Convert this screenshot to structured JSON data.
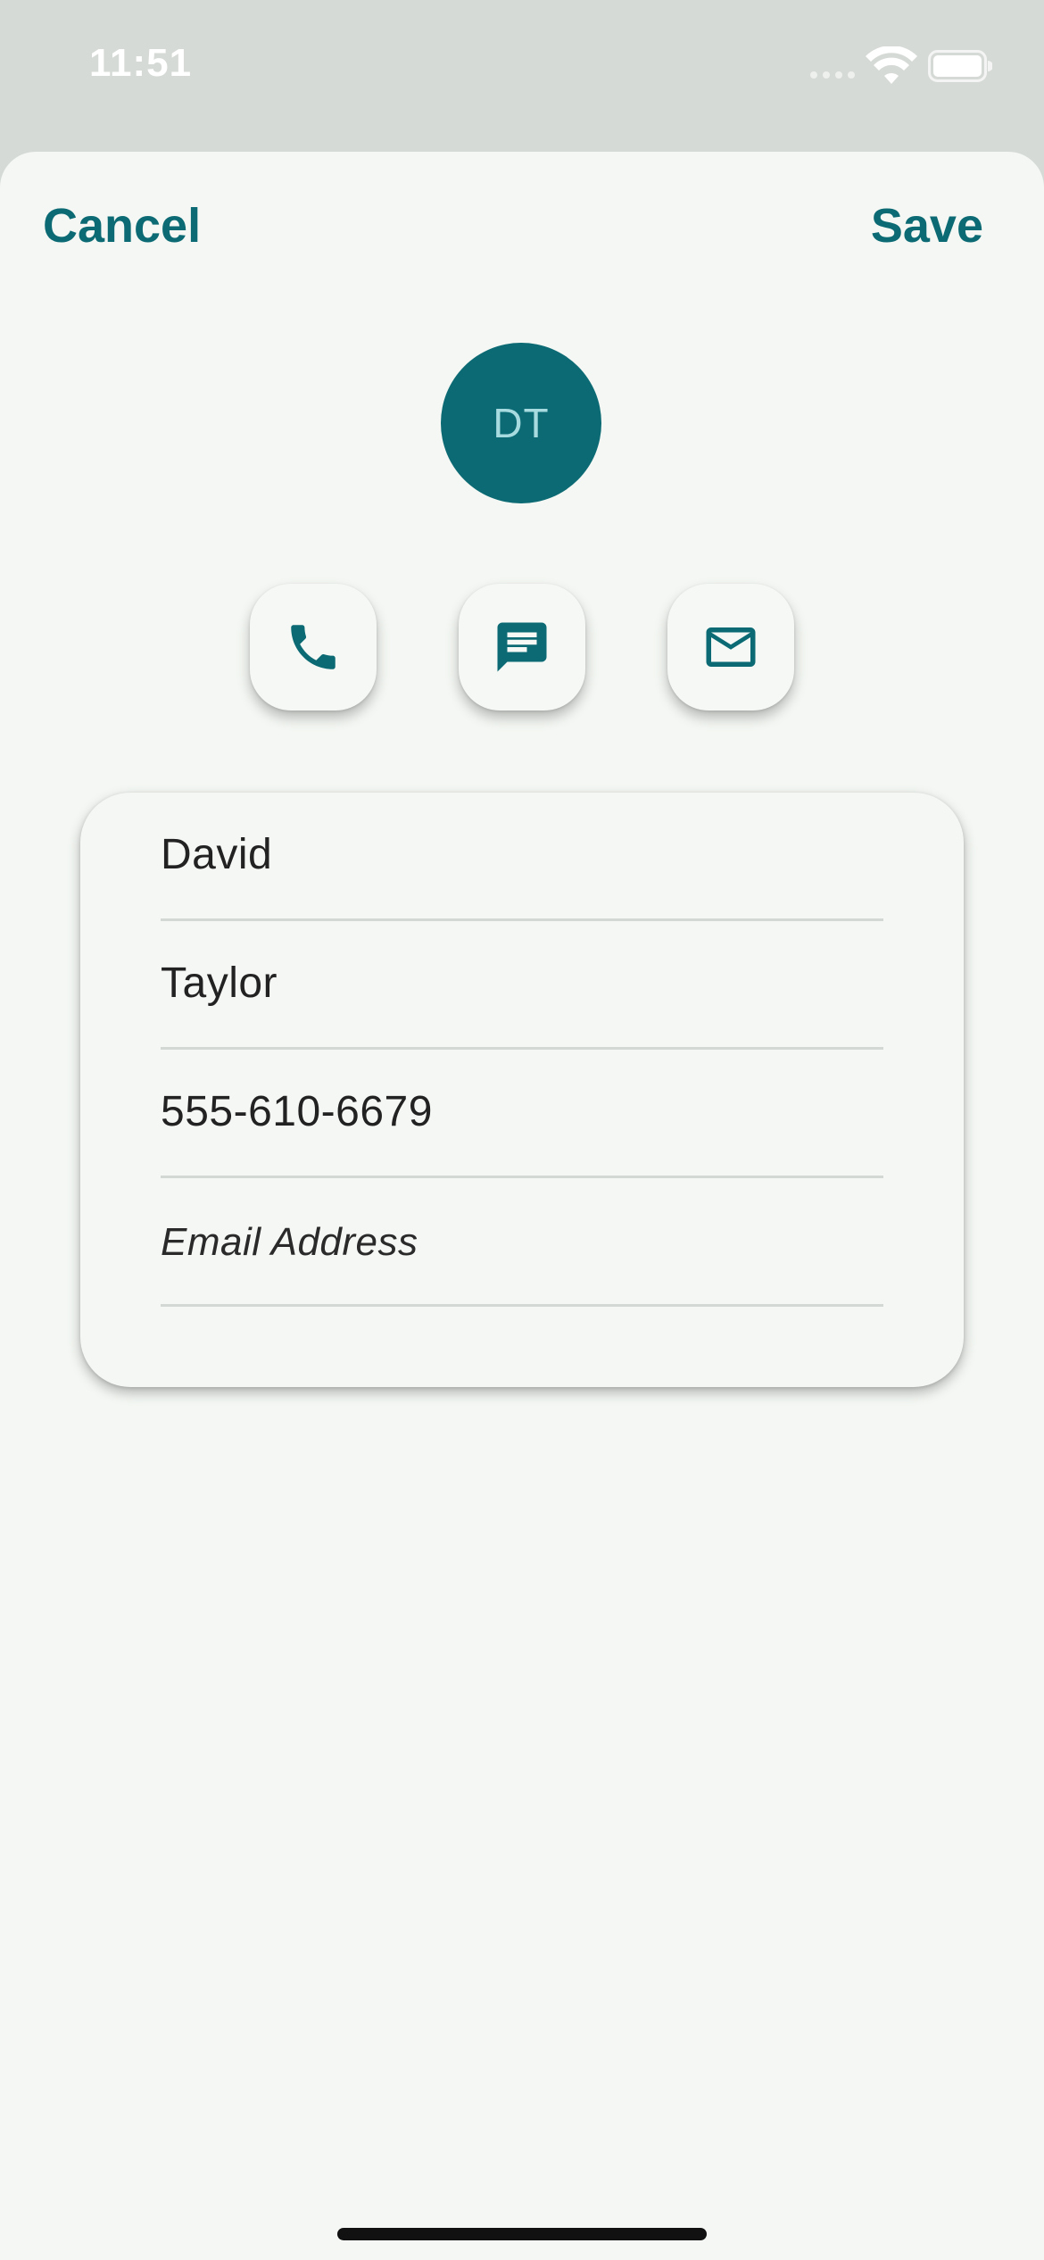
{
  "status_bar": {
    "time": "11:51"
  },
  "header": {
    "cancel_label": "Cancel",
    "save_label": "Save"
  },
  "avatar": {
    "initials": "DT"
  },
  "actions": [
    {
      "name": "call",
      "icon": "phone-icon"
    },
    {
      "name": "message",
      "icon": "message-icon"
    },
    {
      "name": "email",
      "icon": "mail-icon"
    }
  ],
  "form": {
    "first_name": "David",
    "last_name": "Taylor",
    "phone": "555-610-6679",
    "email_placeholder": "Email Address"
  },
  "colors": {
    "accent": "#0b6a73",
    "background": "#f4f7f3",
    "status_bar": "#d6dad6"
  }
}
